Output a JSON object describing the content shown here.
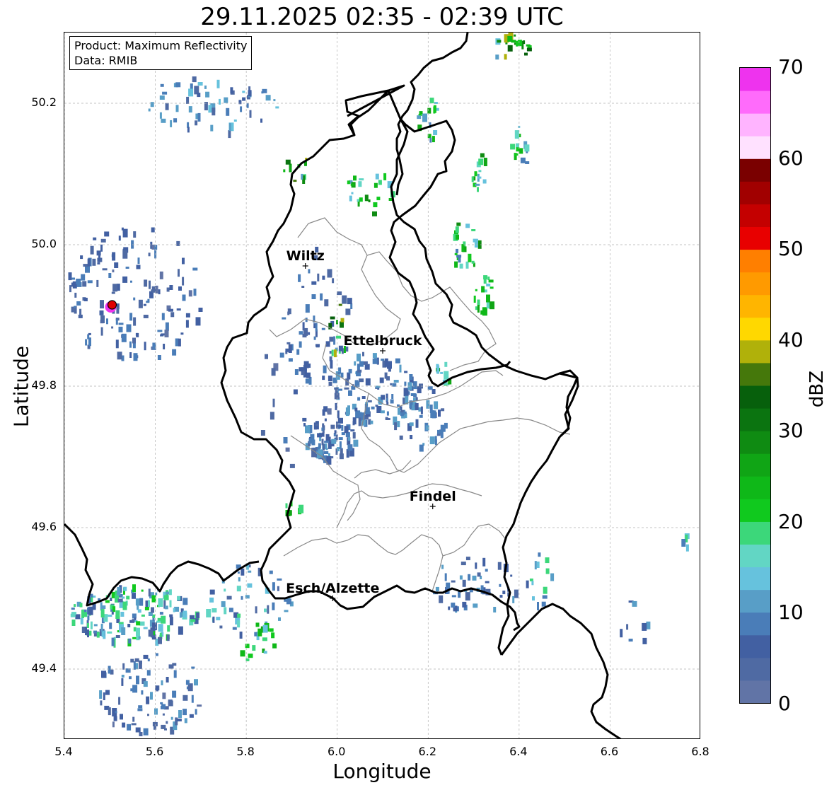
{
  "title": "29.11.2025 02:35 - 02:39 UTC",
  "info_box": {
    "product": "Product: Maximum Reflectivity",
    "data": "Data: RMIB"
  },
  "axes": {
    "xlabel": "Longitude",
    "ylabel": "Latitude",
    "xlim": [
      5.4,
      6.8
    ],
    "ylim": [
      49.3,
      50.3
    ],
    "xticks": [
      "5.4",
      "5.6",
      "5.8",
      "6.0",
      "6.2",
      "6.4",
      "6.6",
      "6.8"
    ],
    "yticks": [
      "49.4",
      "49.6",
      "49.8",
      "50.0",
      "50.2"
    ],
    "grid": true
  },
  "colorbar": {
    "label": "dBZ",
    "ticks": [
      "0",
      "10",
      "20",
      "30",
      "40",
      "50",
      "60",
      "70"
    ],
    "range": [
      0,
      70
    ],
    "colors": [
      "#6174a6",
      "#4f6aa3",
      "#4260a2",
      "#4a7db8",
      "#589ec7",
      "#66c2dd",
      "#62d6c4",
      "#3cd77a",
      "#10c91e",
      "#0fb818",
      "#10a515",
      "#0f8b12",
      "#0b7410",
      "#07600c",
      "#45780b",
      "#b0b10a",
      "#ffd800",
      "#ffb500",
      "#ff9a00",
      "#ff7f00",
      "#e80000",
      "#c40000",
      "#a10000",
      "#7a0000",
      "#ffe1ff",
      "#ffb4ff",
      "#ff6bfb",
      "#ee33ee"
    ]
  },
  "cities": [
    {
      "name": "Wiltz",
      "lon": 5.93,
      "lat": 49.97
    },
    {
      "name": "Ettelbruck",
      "lon": 6.1,
      "lat": 49.85
    },
    {
      "name": "Findel",
      "lon": 6.21,
      "lat": 49.63
    },
    {
      "name": "Esch/Alzette",
      "lon": 5.99,
      "lat": 49.5
    }
  ],
  "radar_site": {
    "lon": 5.505,
    "lat": 49.915
  },
  "echo_regions": [
    {
      "lon": 6.08,
      "lat": 49.8,
      "rlon": 0.1,
      "rlat": 0.05,
      "n": 120,
      "dbz": [
        3,
        12
      ]
    },
    {
      "lon": 5.98,
      "lat": 49.73,
      "rlon": 0.06,
      "rlat": 0.03,
      "n": 70,
      "dbz": [
        3,
        12
      ]
    },
    {
      "lon": 6.18,
      "lat": 49.76,
      "rlon": 0.06,
      "rlat": 0.05,
      "n": 40,
      "dbz": [
        3,
        12
      ]
    },
    {
      "lon": 5.55,
      "lat": 49.48,
      "rlon": 0.14,
      "rlat": 0.04,
      "n": 170,
      "dbz": [
        3,
        22
      ]
    },
    {
      "lon": 5.58,
      "lat": 49.37,
      "rlon": 0.12,
      "rlat": 0.06,
      "n": 90,
      "dbz": [
        2,
        12
      ]
    },
    {
      "lon": 5.72,
      "lat": 50.2,
      "rlon": 0.15,
      "rlat": 0.04,
      "n": 60,
      "dbz": [
        3,
        15
      ]
    },
    {
      "lon": 5.55,
      "lat": 49.93,
      "rlon": 0.15,
      "rlat": 0.1,
      "n": 150,
      "dbz": [
        2,
        10
      ]
    },
    {
      "lon": 6.3,
      "lat": 49.52,
      "rlon": 0.1,
      "rlat": 0.04,
      "n": 50,
      "dbz": [
        3,
        12
      ]
    },
    {
      "lon": 5.8,
      "lat": 49.5,
      "rlon": 0.1,
      "rlat": 0.05,
      "n": 50,
      "dbz": [
        3,
        18
      ]
    },
    {
      "lon": 5.95,
      "lat": 49.9,
      "rlon": 0.08,
      "rlat": 0.1,
      "n": 55,
      "dbz": [
        3,
        10
      ]
    },
    {
      "lon": 6.28,
      "lat": 50.0,
      "rlon": 0.03,
      "rlat": 0.04,
      "n": 25,
      "dbz": [
        8,
        28
      ]
    },
    {
      "lon": 6.32,
      "lat": 49.93,
      "rlon": 0.02,
      "rlat": 0.03,
      "n": 18,
      "dbz": [
        12,
        28
      ]
    },
    {
      "lon": 6.38,
      "lat": 50.28,
      "rlon": 0.04,
      "rlat": 0.02,
      "n": 20,
      "dbz": [
        10,
        40
      ]
    },
    {
      "lon": 6.4,
      "lat": 50.14,
      "rlon": 0.02,
      "rlat": 0.03,
      "n": 14,
      "dbz": [
        8,
        25
      ]
    },
    {
      "lon": 6.31,
      "lat": 50.11,
      "rlon": 0.02,
      "rlat": 0.03,
      "n": 14,
      "dbz": [
        10,
        28
      ]
    },
    {
      "lon": 6.2,
      "lat": 50.18,
      "rlon": 0.03,
      "rlat": 0.03,
      "n": 16,
      "dbz": [
        8,
        28
      ]
    },
    {
      "lon": 6.07,
      "lat": 50.08,
      "rlon": 0.05,
      "rlat": 0.04,
      "n": 24,
      "dbz": [
        10,
        30
      ]
    },
    {
      "lon": 5.91,
      "lat": 50.11,
      "rlon": 0.03,
      "rlat": 0.02,
      "n": 10,
      "dbz": [
        12,
        40
      ]
    },
    {
      "lon": 6.0,
      "lat": 49.88,
      "rlon": 0.02,
      "rlat": 0.04,
      "n": 12,
      "dbz": [
        10,
        40
      ]
    },
    {
      "lon": 6.23,
      "lat": 49.82,
      "rlon": 0.02,
      "rlat": 0.02,
      "n": 10,
      "dbz": [
        12,
        26
      ]
    },
    {
      "lon": 6.45,
      "lat": 49.53,
      "rlon": 0.04,
      "rlat": 0.04,
      "n": 14,
      "dbz": [
        6,
        20
      ]
    },
    {
      "lon": 6.65,
      "lat": 49.46,
      "rlon": 0.03,
      "rlat": 0.04,
      "n": 8,
      "dbz": [
        4,
        12
      ]
    },
    {
      "lon": 5.9,
      "lat": 49.63,
      "rlon": 0.02,
      "rlat": 0.01,
      "n": 6,
      "dbz": [
        18,
        30
      ]
    },
    {
      "lon": 5.82,
      "lat": 49.44,
      "rlon": 0.04,
      "rlat": 0.03,
      "n": 16,
      "dbz": [
        10,
        26
      ]
    },
    {
      "lon": 6.76,
      "lat": 49.58,
      "rlon": 0.01,
      "rlat": 0.02,
      "n": 4,
      "dbz": [
        8,
        20
      ]
    },
    {
      "lon": 5.93,
      "lat": 49.78,
      "rlon": 0.12,
      "rlat": 0.1,
      "n": 40,
      "dbz": [
        2,
        8
      ]
    }
  ]
}
